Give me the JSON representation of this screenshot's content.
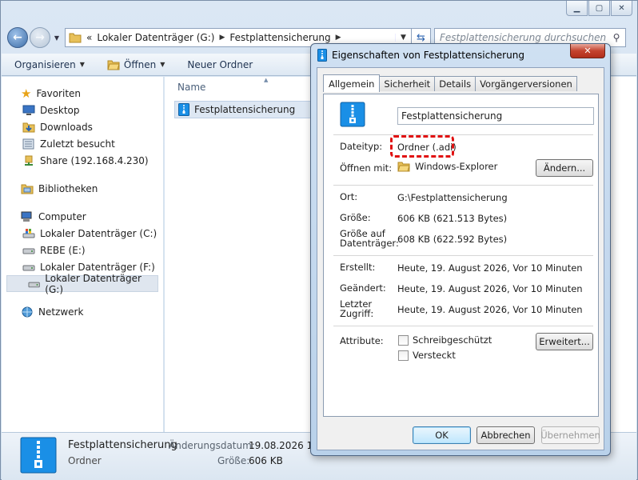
{
  "explorer": {
    "window_buttons": [
      "▁",
      "▢",
      "✕"
    ],
    "breadcrumb": {
      "prefix": "«",
      "parts": [
        "Lokaler Datenträger (G:)",
        "Festplattensicherung"
      ]
    },
    "search_placeholder": "Festplattensicherung durchsuchen",
    "toolbar": {
      "organize": "Organisieren",
      "open": "Öffnen",
      "new_folder": "Neuer Ordner"
    },
    "sidebar": {
      "favorites": "Favoriten",
      "favorites_items": [
        "Desktop",
        "Downloads",
        "Zuletzt besucht",
        "Share (192.168.4.230)"
      ],
      "libraries": "Bibliotheken",
      "computer": "Computer",
      "drives": [
        "Lokaler Datenträger (C:)",
        "REBE (E:)",
        "Lokaler Datenträger (F:)",
        "Lokaler Datenträger (G:)"
      ],
      "network": "Netzwerk"
    },
    "content": {
      "column_name": "Name",
      "files": [
        "Festplattensicherung"
      ]
    },
    "details": {
      "name": "Festplattensicherung",
      "type": "Ordner",
      "date_label": "Änderungsdatum:",
      "date_value": "19.08.2026 10:4",
      "size_label": "Größe:",
      "size_value": "606 KB"
    }
  },
  "dialog": {
    "title": "Eigenschaften von Festplattensicherung",
    "close": "✕",
    "tabs": [
      "Allgemein",
      "Sicherheit",
      "Details",
      "Vorgängerversionen"
    ],
    "name_value": "Festplattensicherung",
    "filetype_label": "Dateityp:",
    "filetype_value": "Ordner (.adi)",
    "open_with_label": "Öffnen mit:",
    "open_with_value": "Windows-Explorer",
    "change_button": "Ändern...",
    "location_label": "Ort:",
    "location_value": "G:\\Festplattensicherung",
    "size_label": "Größe:",
    "size_value": "606 KB (621.513 Bytes)",
    "size_on_disk_label": "Größe auf Datenträger:",
    "size_on_disk_value": "608 KB (622.592 Bytes)",
    "created_label": "Erstellt:",
    "created_value": "Heute, 19. August 2026, Vor 10 Minuten",
    "modified_label": "Geändert:",
    "modified_value": "Heute, 19. August 2026, Vor 10 Minuten",
    "accessed_label": "Letzter Zugriff:",
    "accessed_value": "Heute, 19. August 2026, Vor 10 Minuten",
    "attributes_label": "Attribute:",
    "readonly_label": "Schreibgeschützt",
    "hidden_label": "Versteckt",
    "advanced_button": "Erweitert...",
    "ok_button": "OK",
    "cancel_button": "Abbrechen",
    "apply_button": "Übernehmen"
  },
  "colors": {
    "accent_blue": "#2b63b0",
    "highlight_red": "#e01010",
    "zip_icon_blue": "#1a8fe6"
  }
}
